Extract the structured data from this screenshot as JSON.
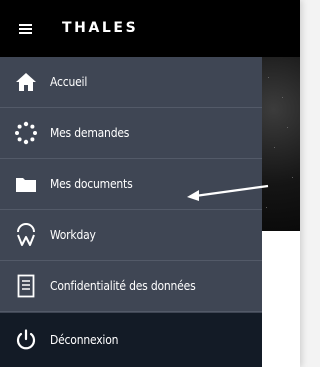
{
  "brand": {
    "logo_text": "THALES"
  },
  "menu": {
    "items": [
      {
        "label": "Accueil",
        "icon": "home-icon"
      },
      {
        "label": "Mes demandes",
        "icon": "loading-dots-icon"
      },
      {
        "label": "Mes documents",
        "icon": "folder-icon"
      },
      {
        "label": "Workday",
        "icon": "workday-icon"
      },
      {
        "label": "Confidentialité des données",
        "icon": "document-icon"
      },
      {
        "label": "Déconnexion",
        "icon": "power-icon"
      }
    ]
  },
  "colors": {
    "topbar": "#000000",
    "sidebar": "#3f4654",
    "logout_bg": "#131b26",
    "text": "#ffffff"
  }
}
